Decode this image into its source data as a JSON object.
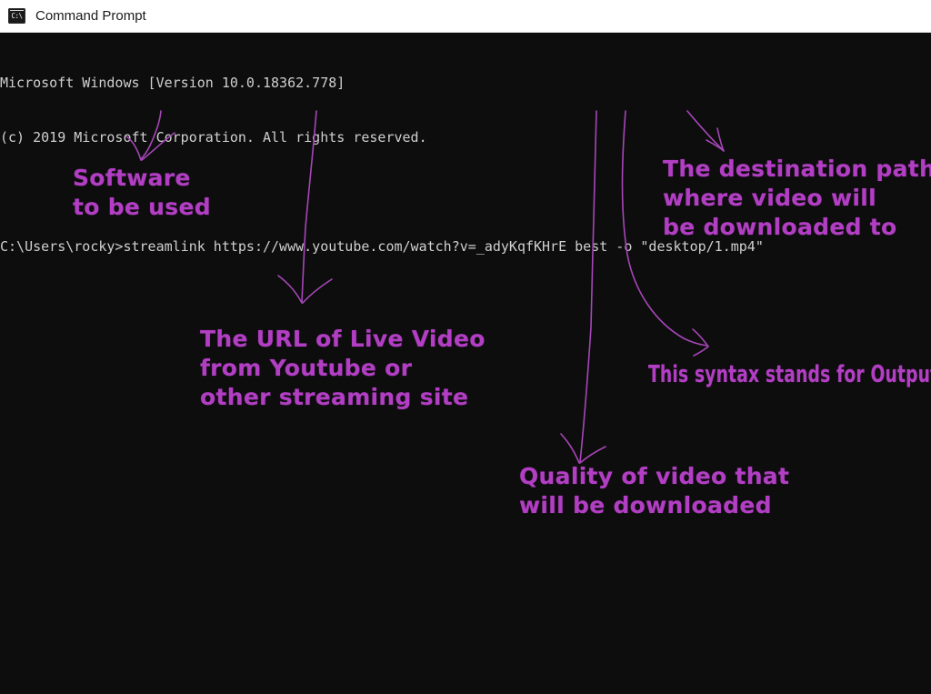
{
  "window": {
    "title": "Command Prompt",
    "icon": "command-prompt-icon",
    "icon_glyph": "C:\\",
    "background_color": "#0d0d0d",
    "titlebar_color": "#ffffff"
  },
  "terminal": {
    "text_color": "#cfcfcf",
    "lines": [
      "Microsoft Windows [Version 10.0.18362.778]",
      "(c) 2019 Microsoft Corporation. All rights reserved.",
      "",
      "C:\\Users\\rocky>streamlink https://www.youtube.com/watch?v=_adyKqfKHrE best -o \"desktop/1.mp4\""
    ],
    "prompt": "C:\\Users\\rocky>",
    "command": "streamlink https://www.youtube.com/watch?v=_adyKqfKHrE best -o \"desktop/1.mp4\""
  },
  "annotations": {
    "color": "#b23ec4",
    "items": [
      {
        "id": "software",
        "text": "Software\nto be used",
        "target": "streamlink"
      },
      {
        "id": "url",
        "text": "The URL of Live Video\nfrom Youtube or\nother streaming site",
        "target": "https://www.youtube.com/watch?v=_adyKqfKHrE"
      },
      {
        "id": "destination",
        "text": "The destination path\nwhere video will\nbe downloaded to",
        "target": "\"desktop/1.mp4\""
      },
      {
        "id": "syntax",
        "text": "This syntax stands for Output",
        "target": "-o"
      },
      {
        "id": "quality",
        "text": "Quality of video that\nwill be downloaded",
        "target": "best"
      }
    ]
  }
}
